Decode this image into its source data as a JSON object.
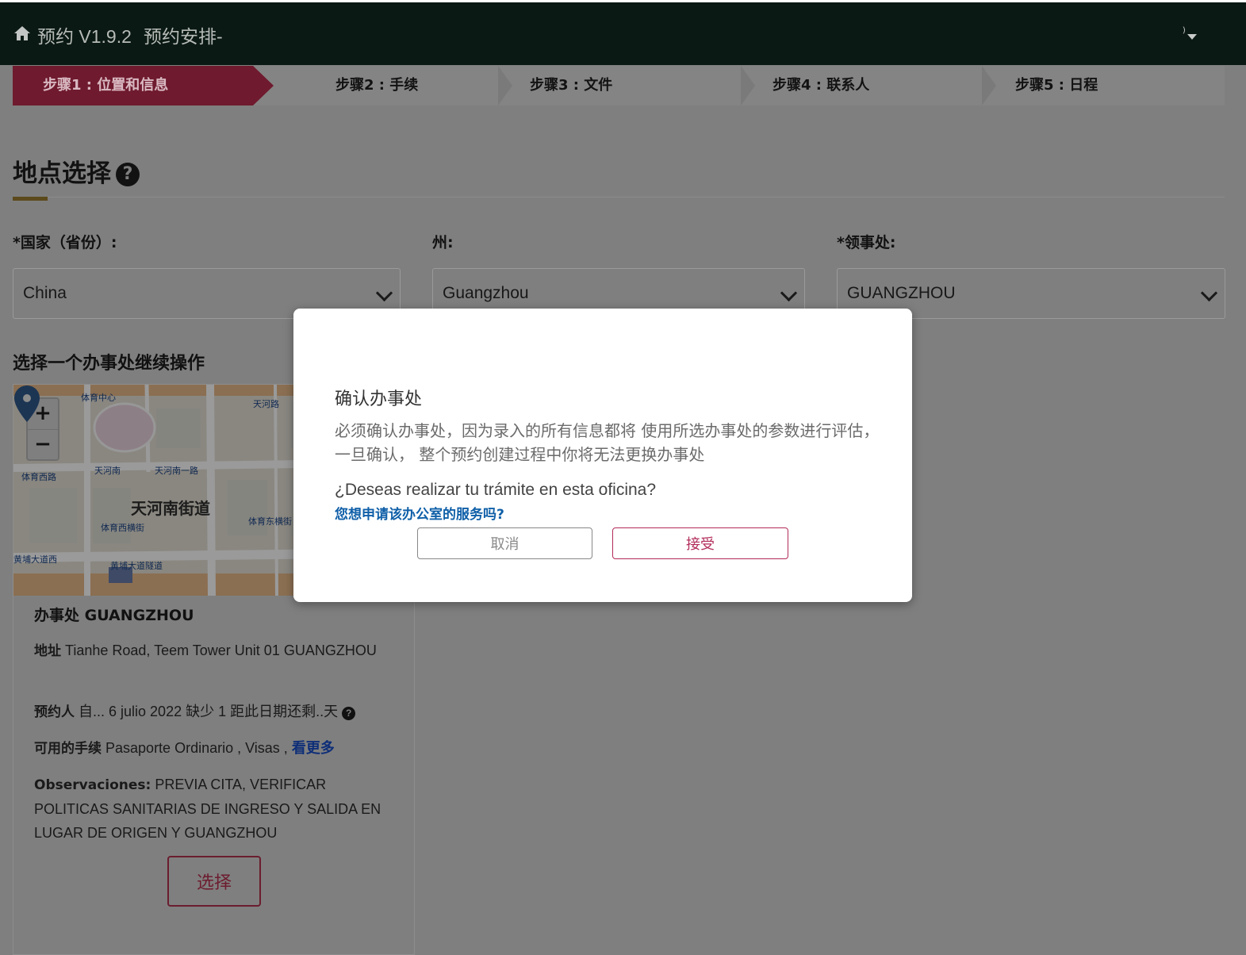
{
  "header": {
    "brand": "预约 V1.9.2",
    "page_title": "预约安排-",
    "user_menu": "⁾"
  },
  "steps": [
    {
      "label": "步骤1 : 位置和信息",
      "active": true
    },
    {
      "label": "步骤2 : 手续",
      "active": false
    },
    {
      "label": "步骤3 : 文件",
      "active": false
    },
    {
      "label": "步骤4 : 联系人",
      "active": false
    },
    {
      "label": "步骤5 : 日程",
      "active": false
    }
  ],
  "section": {
    "title": "地点选择",
    "help_glyph": "?"
  },
  "fields": {
    "country": {
      "label": "*国家（省份）:",
      "value": "China"
    },
    "state": {
      "label": "州:",
      "value": "Guangzhou"
    },
    "consulate": {
      "label": "*领事处:",
      "value": "GUANGZHOU"
    }
  },
  "offices_title": "选择一个办事处继续操作",
  "map": {
    "zoom_in": "+",
    "zoom_out": "−",
    "labels": {
      "district": "天河南街道",
      "s1": "体育中心",
      "s2": "天河路",
      "s3": "天河南",
      "s4": "天河南一路",
      "s5": "体育西路",
      "s6": "黄埔大道隧道",
      "s7": "黄埔大道西",
      "s8": "体育西横街",
      "s9": "体育东横街"
    }
  },
  "office": {
    "name": "办事处 GUANGZHOU",
    "address_label": "地址",
    "address_value": "Tianhe Road, Teem Tower Unit 01 GUANGZHOU",
    "booking_label": "预约人",
    "booking_value": "自... 6 julio 2022 缺少 1 距此日期还剩..天",
    "procedures_label": "可用的手续",
    "procedures_value": "Pasaporte Ordinario , Visas ,",
    "see_more": "看更多",
    "notes_label": "Observaciones:",
    "notes_value": "PREVIA CITA, VERIFICAR POLITICAS SANITARIAS DE INGRESO Y SALIDA EN LUGAR DE ORIGEN Y GUANGZHOU",
    "select_button": "选择"
  },
  "modal": {
    "title": "确认办事处",
    "body": "必须确认办事处，因为录入的所有信息都将 使用所选办事处的参数进行评估，一旦确认， 整个预约创建过程中你将无法更换办事处",
    "question": "¿Deseas realizar tu trámite en esta oficina?",
    "question_cn": "您想申请该办公室的服务吗?",
    "cancel": "取消",
    "accept": "接受"
  },
  "colors": {
    "topbar": "#0a1913",
    "accent": "#6f1a2e",
    "accept": "#b22b5a",
    "link": "#0f5fa8",
    "overlay": "#7f7f7f"
  }
}
